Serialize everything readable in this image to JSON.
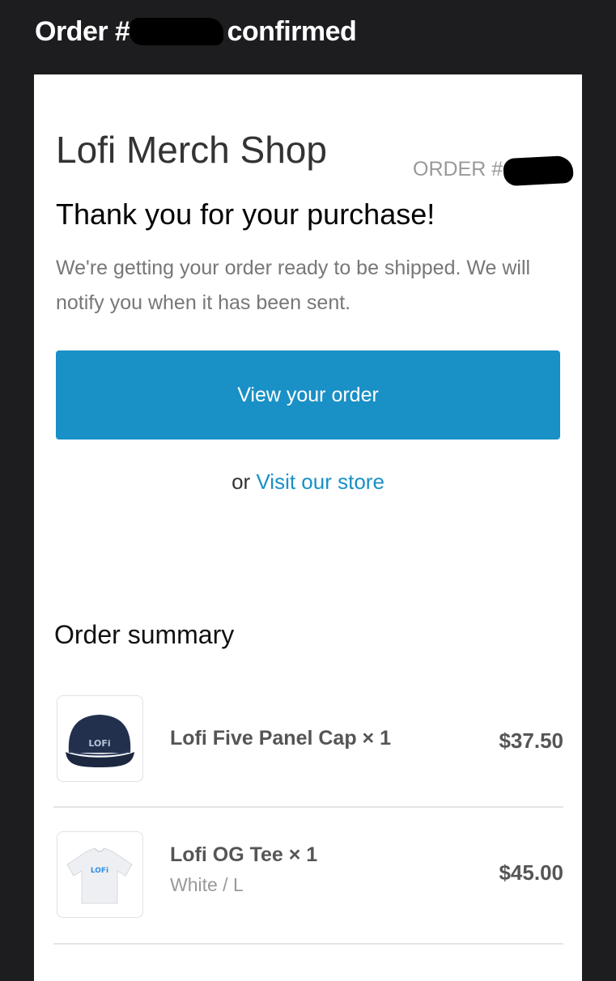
{
  "email": {
    "subject_prefix": "Order #",
    "subject_suffix": "confirmed"
  },
  "header": {
    "shop_name": "Lofi Merch Shop",
    "order_label": "ORDER #"
  },
  "confirmation": {
    "heading": "Thank you for your purchase!",
    "message": "We're getting your order ready to be shipped. We will notify you when it has been sent."
  },
  "actions": {
    "view_order_label": "View your order",
    "or_text": "or",
    "visit_store_label": "Visit our store"
  },
  "summary": {
    "heading": "Order summary",
    "items": [
      {
        "title": "Lofi Five Panel Cap × 1",
        "variant": "",
        "price": "$37.50",
        "thumb_label": "LOFi",
        "icon": "cap-icon"
      },
      {
        "title": "Lofi OG Tee × 1",
        "variant": "White / L",
        "price": "$45.00",
        "thumb_label": "LOFi",
        "icon": "tshirt-icon"
      }
    ]
  },
  "colors": {
    "background": "#1d1c1f",
    "card": "#ffffff",
    "accent": "#1990c6",
    "cap": "#23304d",
    "cap_text": "#b8c4dc",
    "tee": "#eeeff2",
    "tee_text": "#2f8fe0"
  }
}
